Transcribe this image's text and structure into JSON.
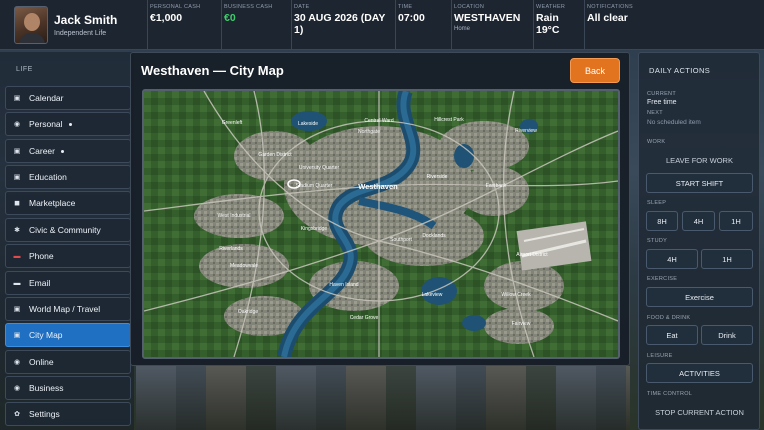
{
  "profile": {
    "name": "Jack Smith",
    "subtitle": "Independent Life"
  },
  "stats": {
    "personal_cash": {
      "label": "PERSONAL CASH",
      "value": "€1,000"
    },
    "business_cash": {
      "label": "BUSINESS CASH",
      "value": "€0"
    },
    "date": {
      "label": "DATE",
      "value": "30 AUG 2026 (DAY 1)"
    },
    "time": {
      "label": "TIME",
      "value": "07:00"
    },
    "location": {
      "label": "LOCATION",
      "value": "WESTHAVEN",
      "sub": "Home"
    },
    "weather": {
      "label": "WEATHER",
      "value": "Rain 19°C"
    },
    "notifications": {
      "label": "NOTIFICATIONS",
      "value": "All clear"
    }
  },
  "sidebar": {
    "heading": "LIFE",
    "items": [
      {
        "label": "Calendar",
        "icon": "calendar-icon",
        "glyph": "▣",
        "dot": false,
        "active": false
      },
      {
        "label": "Personal",
        "icon": "person-icon",
        "glyph": "◉",
        "dot": true,
        "active": false
      },
      {
        "label": "Career",
        "icon": "briefcase-icon",
        "glyph": "▣",
        "dot": true,
        "active": false
      },
      {
        "label": "Education",
        "icon": "book-icon",
        "glyph": "▣",
        "dot": false,
        "active": false
      },
      {
        "label": "Marketplace",
        "icon": "cart-icon",
        "glyph": "◼",
        "dot": false,
        "active": false
      },
      {
        "label": "Civic & Community",
        "icon": "community-icon",
        "glyph": "✱",
        "dot": false,
        "active": false
      },
      {
        "label": "Phone",
        "icon": "phone-icon",
        "glyph": "▬",
        "dot": false,
        "active": false
      },
      {
        "label": "Email",
        "icon": "mail-icon",
        "glyph": "▬",
        "dot": false,
        "active": false
      },
      {
        "label": "World Map / Travel",
        "icon": "globe-icon",
        "glyph": "▣",
        "dot": false,
        "active": false
      },
      {
        "label": "City Map",
        "icon": "map-icon",
        "glyph": "▣",
        "dot": false,
        "active": true
      },
      {
        "label": "Online",
        "icon": "online-icon",
        "glyph": "◉",
        "dot": false,
        "active": false
      },
      {
        "label": "Business",
        "icon": "business-icon",
        "glyph": "◉",
        "dot": false,
        "active": false
      },
      {
        "label": "Settings",
        "icon": "gear-icon",
        "glyph": "✿",
        "dot": false,
        "active": false
      }
    ]
  },
  "map": {
    "title": "Westhaven — City Map",
    "back_label": "Back",
    "places": {
      "greenleft": "Greenleft",
      "lakeside": "Lakeside",
      "central_ward": "Central Ward",
      "northgate": "Northgate",
      "hillcrest_park": "Hillcrest Park",
      "riverview": "Riverview",
      "garden_district": "Garden District",
      "university_quarter": "University Quarter",
      "stadium_quarter": "Stadium Quarter",
      "westhaven": "Westhaven",
      "riverside": "Riverside",
      "eastbank": "Eastbank",
      "west_industrial": "West Industrial",
      "kingsbridge": "Kingsbridge",
      "docklands": "Docklands",
      "southport": "Southport",
      "riverlands": "Riverlands",
      "meadowvale": "Meadowvale",
      "airport_district": "Airport District",
      "haven_island": "Haven Island",
      "lakeview": "Lakeview",
      "willow_creek": "Willow Creek",
      "oakridge": "Oakridge",
      "cedar_grove": "Cedar Grove",
      "fairview": "Fairview"
    }
  },
  "daily": {
    "title": "DAILY ACTIONS",
    "current_label": "CURRENT",
    "current_value": "Free time",
    "next_label": "NEXT",
    "next_value": "No scheduled item",
    "work_label": "WORK",
    "leave_work": "LEAVE FOR WORK",
    "start_shift": "START SHIFT",
    "sleep_label": "SLEEP",
    "sleep_8h": "8H",
    "sleep_4h": "4H",
    "sleep_1h": "1H",
    "study_label": "STUDY",
    "study_4h": "4H",
    "study_1h": "1H",
    "exercise_label": "EXERCISE",
    "exercise_btn": "Exercise",
    "food_label": "FOOD & DRINK",
    "eat": "Eat",
    "drink": "Drink",
    "leisure_label": "LEISURE",
    "activities": "ACTIVITIES",
    "time_control_label": "TIME CONTROL",
    "stop_action": "STOP CURRENT ACTION"
  }
}
